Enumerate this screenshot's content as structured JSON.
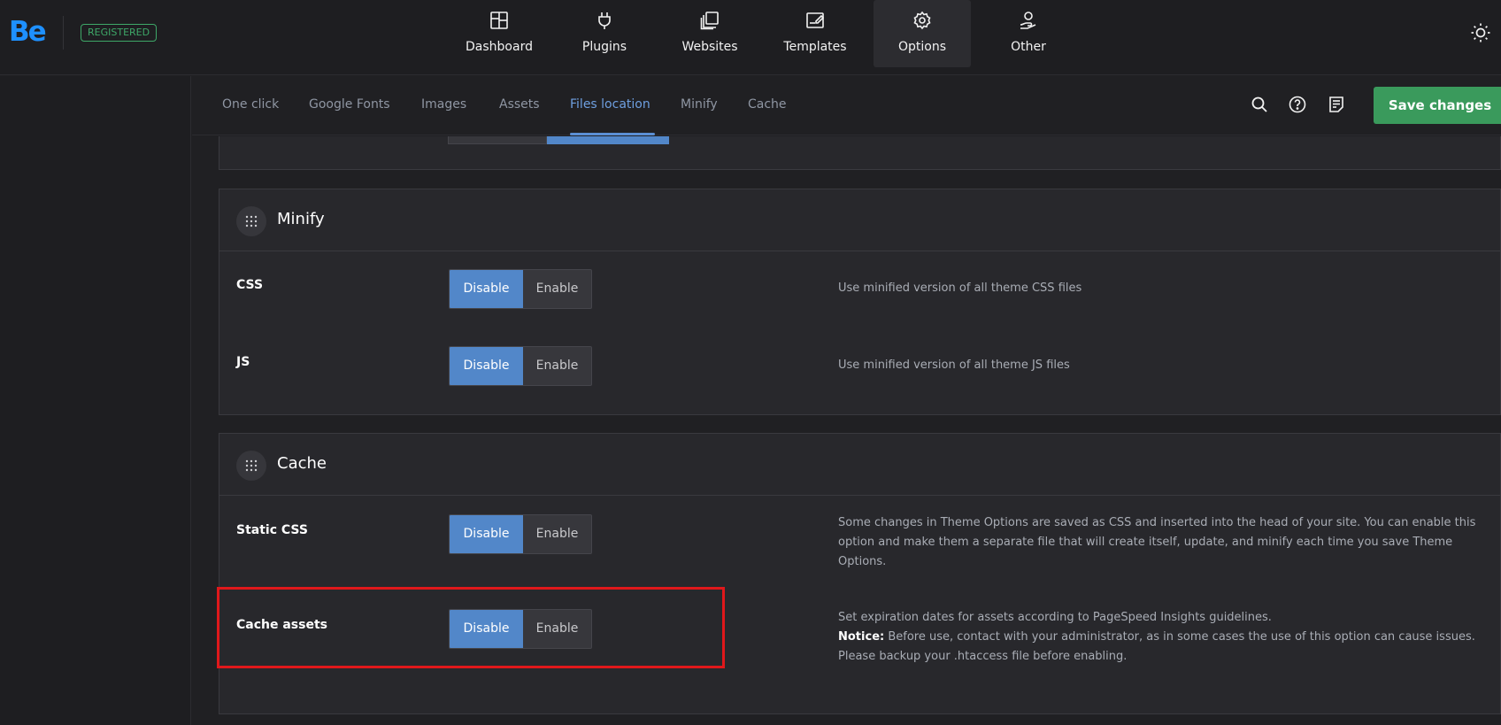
{
  "brand": {
    "logo_text": "Be",
    "badge": "REGISTERED"
  },
  "main_nav": [
    {
      "label": "Dashboard",
      "icon": "dashboard-icon"
    },
    {
      "label": "Plugins",
      "icon": "plug-icon"
    },
    {
      "label": "Websites",
      "icon": "websites-icon"
    },
    {
      "label": "Templates",
      "icon": "templates-icon"
    },
    {
      "label": "Options",
      "icon": "gear-icon",
      "active": true
    },
    {
      "label": "Other",
      "icon": "other-icon"
    }
  ],
  "sub_tabs": [
    {
      "label": "One click"
    },
    {
      "label": "Google Fonts"
    },
    {
      "label": "Images"
    },
    {
      "label": "Assets"
    },
    {
      "label": "Files location",
      "active": true
    },
    {
      "label": "Minify"
    },
    {
      "label": "Cache"
    }
  ],
  "toolbar": {
    "save_label": "Save changes"
  },
  "sections": {
    "minify": {
      "title": "Minify",
      "rows": [
        {
          "label": "CSS",
          "disable": "Disable",
          "enable": "Enable",
          "selected": "Disable",
          "description": "Use minified version of all theme CSS files"
        },
        {
          "label": "JS",
          "disable": "Disable",
          "enable": "Enable",
          "selected": "Disable",
          "description": "Use minified version of all theme JS files"
        }
      ]
    },
    "cache": {
      "title": "Cache",
      "rows": [
        {
          "label": "Static CSS",
          "disable": "Disable",
          "enable": "Enable",
          "selected": "Disable",
          "description": "Some changes in Theme Options are saved as CSS and inserted into the head of your site. You can enable this option and make them a separate file that will create itself, update, and minify each time you save Theme Options."
        },
        {
          "label": "Cache assets",
          "disable": "Disable",
          "enable": "Enable",
          "selected": "Disable",
          "description": "Set expiration dates for assets according to PageSpeed Insights guidelines.",
          "notice_label": "Notice:",
          "notice_text": " Before use, contact with your administrator, as in some cases the use of this option can cause issues. Please backup your .htaccess file before enabling."
        }
      ]
    }
  },
  "colors": {
    "accent": "#5287c9",
    "save": "#3a9a5c",
    "badge": "#3ea768",
    "highlight": "#e0181b"
  }
}
